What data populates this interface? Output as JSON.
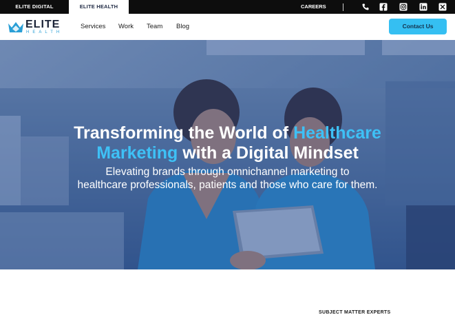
{
  "topbar": {
    "tabs": [
      {
        "label": "ELITE DIGITAL"
      },
      {
        "label": "ELITE HEALTH"
      }
    ],
    "careers_label": "CAREERS",
    "icons": [
      "phone-icon",
      "facebook-icon",
      "instagram-icon",
      "linkedin-icon",
      "x-twitter-icon"
    ]
  },
  "nav": {
    "logo": {
      "word": "ELITE",
      "subword": "HEALTH",
      "crown_color": "#2a9fd6"
    },
    "links": [
      {
        "label": "Services"
      },
      {
        "label": "Work"
      },
      {
        "label": "Team"
      },
      {
        "label": "Blog"
      }
    ],
    "contact_label": "Contact Us"
  },
  "hero": {
    "headline_part1": "Transforming the World of ",
    "headline_highlight1": "Healthcare",
    "headline_highlight2": "Marketing",
    "headline_part2": " with a Digital Mindset",
    "subline1": "Elevating brands through omnichannel marketing to",
    "subline2": "healthcare professionals, patients and those who care for them.",
    "highlight_color": "#3ec1f6"
  },
  "section": {
    "eyebrow": "SUBJECT MATTER EXPERTS"
  },
  "colors": {
    "accent": "#35bff2",
    "dark": "#0d0d0d"
  }
}
